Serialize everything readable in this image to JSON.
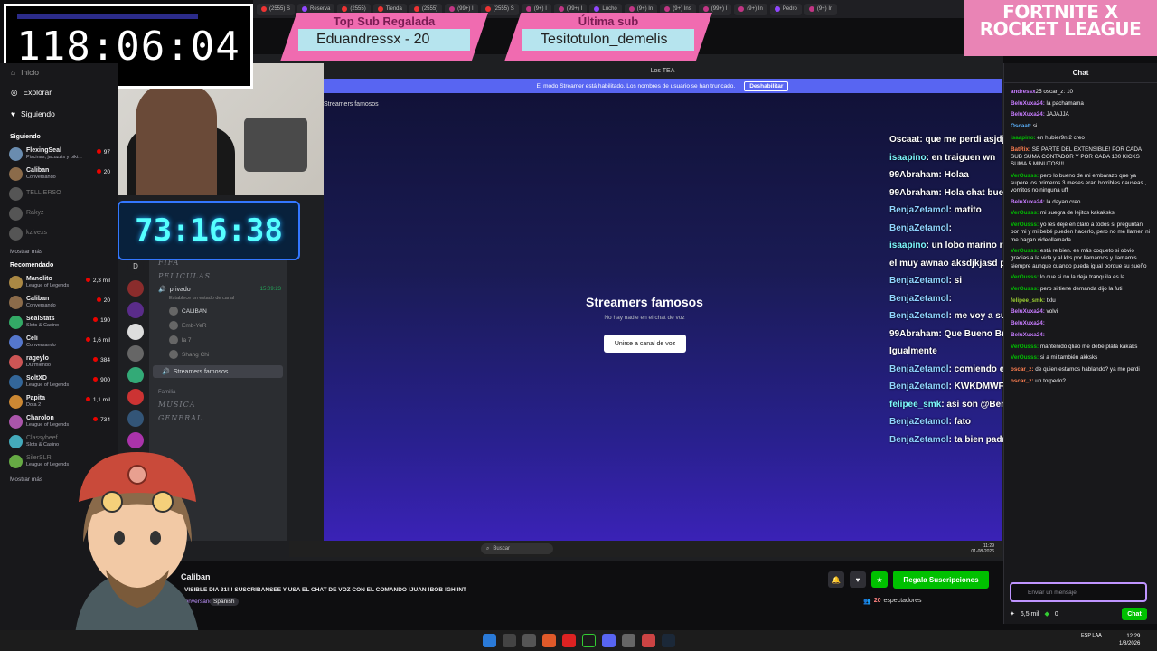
{
  "browser_tabs": [
    {
      "label": "(2555) S",
      "kind": "yt"
    },
    {
      "label": "Reserva",
      "kind": "tw"
    },
    {
      "label": "(2555)",
      "kind": "yt"
    },
    {
      "label": "Tienda",
      "kind": "yt"
    },
    {
      "label": "(2555)",
      "kind": "yt"
    },
    {
      "label": "(99+) I",
      "kind": "ig"
    },
    {
      "label": "(2555) S",
      "kind": "yt"
    },
    {
      "label": "(9+) I",
      "kind": "ig"
    },
    {
      "label": "(99+) I",
      "kind": "ig"
    },
    {
      "label": "Lucho",
      "kind": "tw"
    },
    {
      "label": "(9+) In",
      "kind": "ig"
    },
    {
      "label": "(9+) Ins",
      "kind": "ig"
    },
    {
      "label": "(99+) I",
      "kind": "ig"
    },
    {
      "label": "(9+) In",
      "kind": "ig"
    },
    {
      "label": "Pedro",
      "kind": "tw"
    },
    {
      "label": "(9+) In",
      "kind": "ig"
    }
  ],
  "overlays": {
    "timer_main": "118:06:04",
    "timer_sub": "73:16:38",
    "gift_top": {
      "label": "Top Sub Regalada",
      "value": "Eduandressx - 20"
    },
    "gift_last": {
      "label": "Última sub",
      "value": "Tesitotulon_demelis"
    },
    "event_banner": "FORTNITE X ROCKET LEAGUE"
  },
  "sidebar": {
    "nav": [
      {
        "label": "Inicio"
      },
      {
        "label": "Explorar"
      },
      {
        "label": "Siguiendo"
      }
    ],
    "following_title": "Siguiendo",
    "following": [
      {
        "name": "FlexingSeal",
        "game": "Piscinas, jacuzzis y biki...",
        "viewers": "97",
        "color": "#6a8caf"
      },
      {
        "name": "Caliban",
        "game": "Conversando",
        "viewers": "20",
        "color": "#8b6b4a"
      },
      {
        "name": "TELLIERSO",
        "game": "",
        "viewers": "",
        "color": "#555"
      },
      {
        "name": "Rakyz",
        "game": "",
        "viewers": "",
        "color": "#555"
      },
      {
        "name": "kzivexs",
        "game": "",
        "viewers": "",
        "color": "#555"
      }
    ],
    "show_more_1": "Mostrar más",
    "recommended_title": "Recomendado",
    "recommended": [
      {
        "name": "Manolito",
        "game": "League of Legends",
        "viewers": "2,3 mil",
        "color": "#a84"
      },
      {
        "name": "Caliban",
        "game": "Conversando",
        "viewers": "20",
        "color": "#8b6b4a"
      },
      {
        "name": "SealStats",
        "game": "Slots & Casino",
        "viewers": "190",
        "color": "#3a6"
      },
      {
        "name": "Celi",
        "game": "Conversando",
        "viewers": "1,6 mil",
        "color": "#57c"
      },
      {
        "name": "rageylo",
        "game": "Durmiendo",
        "viewers": "384",
        "color": "#c55"
      },
      {
        "name": "SoltXD",
        "game": "League of Legends",
        "viewers": "900",
        "color": "#369"
      },
      {
        "name": "Papita",
        "game": "Dota 2",
        "viewers": "1,1 mil",
        "color": "#c83"
      },
      {
        "name": "Charolon",
        "game": "League of Legends",
        "viewers": "734",
        "color": "#a5a"
      },
      {
        "name": "Classybeef",
        "game": "Slots & Casino",
        "viewers": "",
        "color": "#4ab"
      },
      {
        "name": "SilerSLR",
        "game": "League of Legends",
        "viewers": "",
        "color": "#6a4"
      }
    ],
    "show_more_2": "Mostrar más"
  },
  "discord": {
    "window_title": "Los TEA",
    "banner_text": "El modo Streamer está habilitado. Los nombres de usuario se han truncado.",
    "banner_button": "Deshabilitar",
    "voice_channel_header": "Streamers famosos",
    "empty_title": "Streamers famosos",
    "empty_subtitle": "No hay nadie en el chat de voz",
    "join_button": "Unirse a canal de voz",
    "categories": [
      "FIFA",
      "PELICULAS"
    ],
    "channel_private": "privado",
    "channel_private_time": "15:09:23",
    "channel_private_status": "Establece un estado de canal",
    "users": [
      "CALIBAN",
      "Emb-YeR",
      "la 7",
      "Shang Chi"
    ],
    "channel_active": "Streamers famosos",
    "category_family": "Familia",
    "family_channels": [
      "MUSICA",
      "GENERAL"
    ],
    "search_label": "Buscar",
    "taskbar_time": "11:29",
    "taskbar_date": "01-08-2026",
    "taskbar_lang": "ESP LAA"
  },
  "overlay_chat": [
    {
      "user": "Oscaat",
      "text": ": que me perdi asjdjasd",
      "cls": "o"
    },
    {
      "user": "isaapino",
      "text": ": en traiguen wn",
      "cls": "g"
    },
    {
      "user": "99Abraham",
      "text": ": Holaa",
      "cls": "o"
    },
    {
      "user": "99Abraham",
      "text": ": Hola chat buen dia",
      "cls": "o"
    },
    {
      "user": "BenjaZetamol",
      "text": ": matito",
      "cls": ""
    },
    {
      "user": "BenjaZetamol",
      "text": ":",
      "cls": ""
    },
    {
      "user": "isaapino",
      "text": ": un lobo marino recorrió del mar hacia rio arriba",
      "cls": "g"
    },
    {
      "user": "",
      "text": "el muy awnao aksdjkjasd pobrecilito",
      "cls": "o"
    },
    {
      "user": "BenjaZetamol",
      "text": ": si",
      "cls": ""
    },
    {
      "user": "BenjaZetamol",
      "text": ":",
      "cls": ""
    },
    {
      "user": "BenjaZetamol",
      "text": ": me voy a suicidar",
      "cls": ""
    },
    {
      "user": "99Abraham",
      "text": ": Que Bueno Bro Me alegro, Yo Bien",
      "cls": "o"
    },
    {
      "user": "",
      "text": "Igualmente",
      "cls": "o"
    },
    {
      "user": "BenjaZetamol",
      "text": ": comiendo empanada",
      "cls": ""
    },
    {
      "user": "BenjaZetamol",
      "text": ": KWKDMWFMMWFMQ",
      "cls": ""
    },
    {
      "user": "felipee_smk",
      "text": ": asi son @BenjaZetamol",
      "cls": "g"
    },
    {
      "user": "BenjaZetamol",
      "text": ": fato",
      "cls": ""
    },
    {
      "user": "BenjaZetamol",
      "text": ": ta bien padre",
      "cls": ""
    }
  ],
  "chat": {
    "title": "Chat",
    "messages": [
      {
        "user": "andressx",
        "ucls": "b1",
        "text": "25 oscar_z: 10"
      },
      {
        "user": "BeluXuxa24:",
        "ucls": "b1",
        "text": " la pachamama"
      },
      {
        "user": "BeluXuxa24:",
        "ucls": "b1",
        "text": " JAJAJJA"
      },
      {
        "user": "Oscaat:",
        "ucls": "b3",
        "text": " si"
      },
      {
        "user": "isaapino:",
        "ucls": "b2",
        "text": " en hubier9n 2 creo"
      },
      {
        "user": "BatRix:",
        "ucls": "b4",
        "text": " SE PARTE DEL EXTENSIBLE! POR CADA SUB SUMA CONTADOR Y POR CADA 100 KICKS SUMA 5 MINUTOS!!!"
      },
      {
        "user": "VerOusss:",
        "ucls": "b2",
        "text": " pero lo bueno de mi embarazo que ya supere los primeros 3 meses eran horribles nauseas , vomitos no ninguna uff"
      },
      {
        "user": "BeluXuxa24:",
        "ucls": "b1",
        "text": " la dayan creo"
      },
      {
        "user": "VerOusss:",
        "ucls": "b2",
        "text": " mi suegra de lejitos kakaksks"
      },
      {
        "user": "VerOusss:",
        "ucls": "b2",
        "text": " yo les dejé en claro a todos si preguntan por mi y mi bebé pueden hacerlo, pero no me llamen ni me hagan videollamada"
      },
      {
        "user": "VerOusss:",
        "ucls": "b2",
        "text": " está re bien. es más coqueto si obvio gracias a la vida y al kks por llamarnos y llamamis siempre aunque cuando pueda igual porque su sueño"
      },
      {
        "user": "VerOusss:",
        "ucls": "b2",
        "text": " lo que si no la deja tranquila es la"
      },
      {
        "user": "VerOusss:",
        "ucls": "b2",
        "text": " pero si tiene demanda dijo la futi"
      },
      {
        "user": "felipee_smk:",
        "ucls": "b5",
        "text": " txlu"
      },
      {
        "user": "BeluXuxa24:",
        "ucls": "b1",
        "text": " volvi"
      },
      {
        "user": "BeluXuxa24:",
        "ucls": "b1",
        "text": ""
      },
      {
        "user": "BeluXuxa24:",
        "ucls": "b1",
        "text": ""
      },
      {
        "user": "VerOusss:",
        "ucls": "b2",
        "text": " mantenido qliao me debe plata kakaks"
      },
      {
        "user": "VerOusss:",
        "ucls": "b2",
        "text": " si a mi también akksks"
      },
      {
        "user": "oscar_z:",
        "ucls": "b4",
        "text": " de quien estamos hablando? ya me perdi"
      },
      {
        "user": "oscar_z:",
        "ucls": "b4",
        "text": " un torpedo?"
      }
    ],
    "input_placeholder": "Enviar un mensaje",
    "points": "6,5 mil",
    "bits": "0",
    "chat_button": "Chat"
  },
  "channel_info": {
    "name": "Caliban",
    "title": "VISIBLE DIA 31!!! SUSCRIBANSEE Y USA EL CHAT DE VOZ CON EL COMANDO !JUAN !BOB !GH INT",
    "category": "Conversando",
    "tag": "Spanish",
    "viewers": "20",
    "viewers_label": "espectadores",
    "gift_button": "Regala Suscripciones"
  },
  "taskbar": {
    "time": "12:29",
    "date": "1/8/2026",
    "lang": "ESP LAA"
  }
}
